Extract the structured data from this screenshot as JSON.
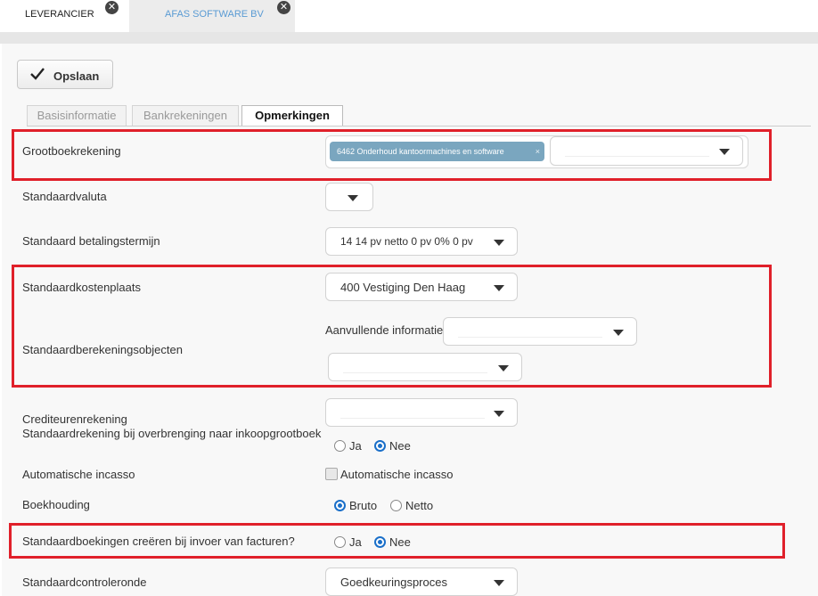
{
  "tabs": [
    {
      "label": "LEVERANCIER"
    },
    {
      "label": "AFAS SOFTWARE BV"
    }
  ],
  "tab_close_glyph": "✕",
  "toolbar": {
    "save_label": "Opslaan",
    "save_icon": "check-icon"
  },
  "inner_tabs": [
    {
      "label": "Basisinformatie"
    },
    {
      "label": "Bankrekeningen"
    },
    {
      "label": "Opmerkingen"
    }
  ],
  "fields": {
    "grootboekrekening": {
      "label": "Grootboekrekening",
      "chip": "6462 Onderhoud kantoormachines en software",
      "chip_remove": "×"
    },
    "standaardvaluta": {
      "label": "Standaardvaluta"
    },
    "betalingstermijn": {
      "label": "Standaard betalingstermijn",
      "value": "14 14 pv netto 0 pv 0% 0 pv"
    },
    "kostenplaats": {
      "label": "Standaardkostenplaats",
      "value": "400 Vestiging Den Haag"
    },
    "berekeningsobjecten": {
      "label": "Standaardberekeningsobjecten",
      "aanvullend_label": "Aanvullende informatie"
    },
    "crediteurenrekening": {
      "label": "Crediteurenrekening"
    },
    "overbrenging": {
      "label": "Standaardrekening bij overbrenging naar inkoopgrootboek",
      "opt_ja": "Ja",
      "opt_nee": "Nee",
      "selected": "Nee"
    },
    "incasso": {
      "label": "Automatische incasso",
      "checkbox_label": "Automatische incasso",
      "checked": false
    },
    "boekhouding": {
      "label": "Boekhouding",
      "opt_bruto": "Bruto",
      "opt_netto": "Netto",
      "selected": "Bruto"
    },
    "standaardboekingen": {
      "label": "Standaardboekingen creëren bij invoer van facturen?",
      "opt_ja": "Ja",
      "opt_nee": "Nee",
      "selected": "Nee"
    },
    "controleronde": {
      "label": "Standaardcontroleronde",
      "value": "Goedkeuringsproces"
    }
  },
  "colors": {
    "highlight": "#e0202a",
    "radio_selected": "#1a6fc9",
    "chip_bg": "#7aa6bf",
    "active_tab_text": "#5a9bd4"
  }
}
